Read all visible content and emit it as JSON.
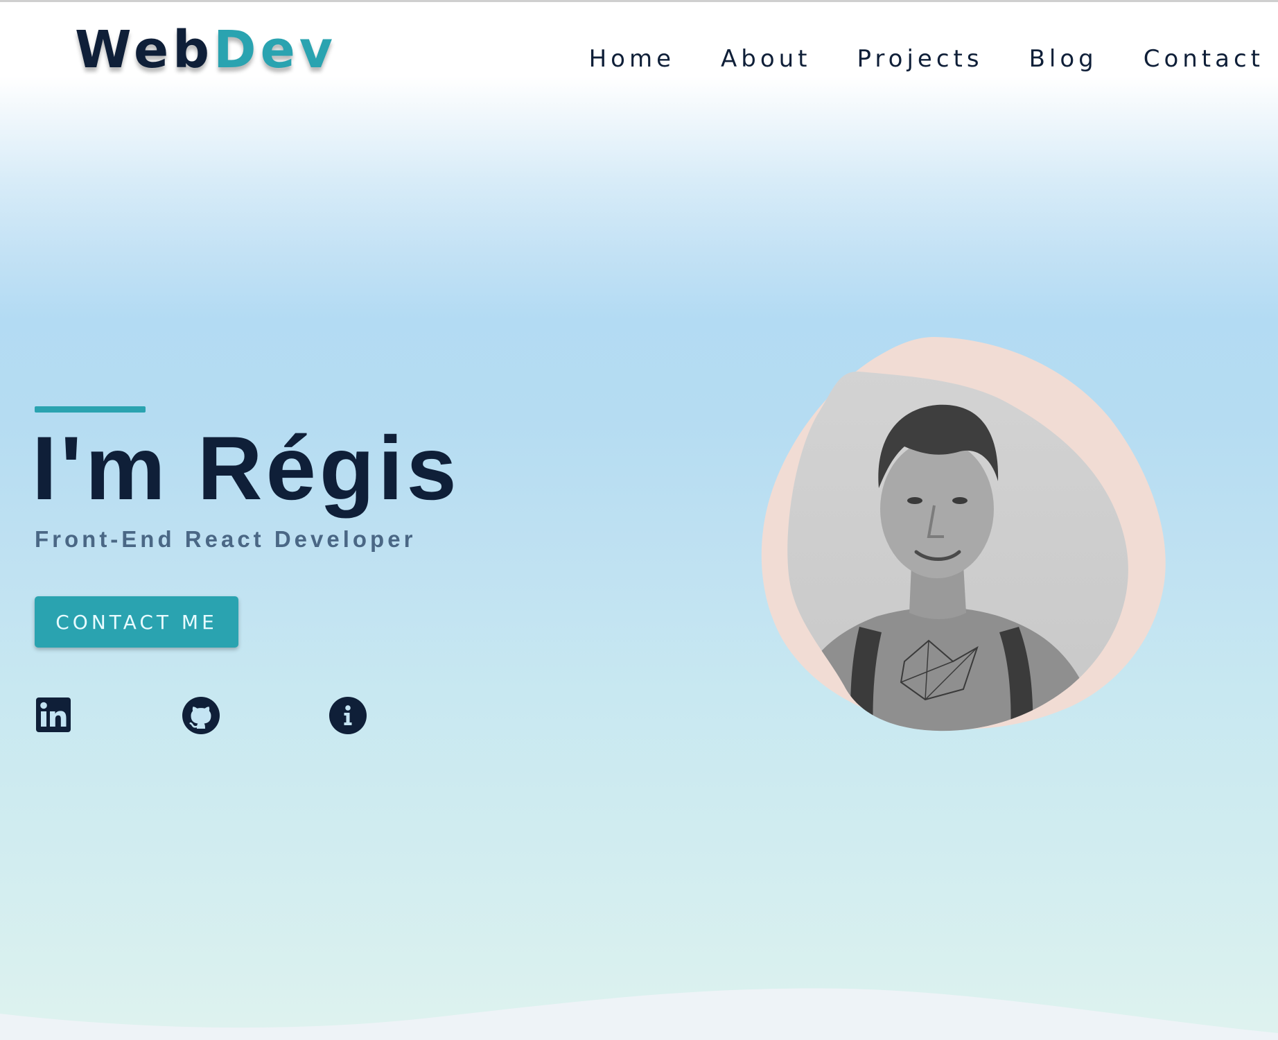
{
  "header": {
    "logo": {
      "part1": "Web",
      "part2": "Dev"
    },
    "nav": [
      {
        "label": "Home"
      },
      {
        "label": "About"
      },
      {
        "label": "Projects"
      },
      {
        "label": "Blog"
      },
      {
        "label": "Contact"
      }
    ]
  },
  "hero": {
    "title": "I'm Régis",
    "subtitle": "Front-End React Developer",
    "cta_label": "CONTACT ME",
    "social": [
      {
        "icon": "linkedin-icon"
      },
      {
        "icon": "github-icon"
      },
      {
        "icon": "info-icon"
      }
    ],
    "portrait": {
      "icon": "profile-photo"
    }
  },
  "colors": {
    "primary": "#0f1f38",
    "accent": "#2aa3b0",
    "subtitle": "#4a6785",
    "blob": "#f1dcd4"
  }
}
